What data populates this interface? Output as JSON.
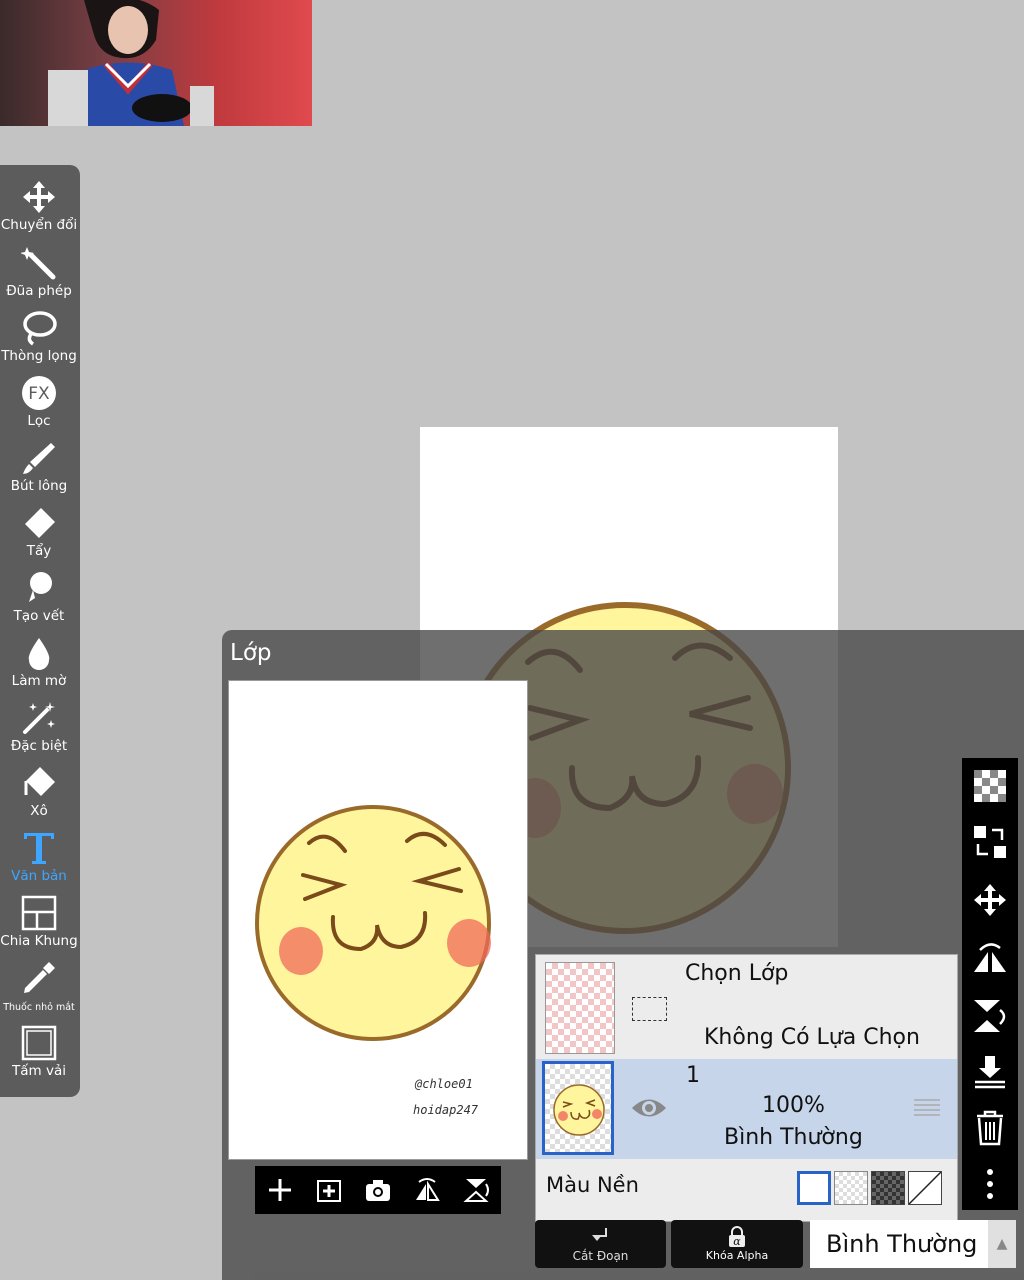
{
  "tools": [
    {
      "label": "Chuyển đổi",
      "icon": "move-icon"
    },
    {
      "label": "Đũa phép",
      "icon": "magic-wand-icon"
    },
    {
      "label": "Thòng lọng",
      "icon": "lasso-icon"
    },
    {
      "label": "Lọc",
      "icon": "fx-filter-icon"
    },
    {
      "label": "Bút lông",
      "icon": "brush-icon"
    },
    {
      "label": "Tẩy",
      "icon": "eraser-icon"
    },
    {
      "label": "Tạo vết",
      "icon": "smudge-icon"
    },
    {
      "label": "Làm mờ",
      "icon": "blur-drop-icon"
    },
    {
      "label": "Đặc biệt",
      "icon": "special-brush-icon"
    },
    {
      "label": "Xô",
      "icon": "bucket-icon"
    },
    {
      "label": "Văn bản",
      "icon": "text-icon",
      "active": true
    },
    {
      "label": "Chia Khung",
      "icon": "frame-divider-icon"
    },
    {
      "label": "Thuốc nhỏ mắt",
      "icon": "eyedropper-icon"
    },
    {
      "label": "Tấm vải",
      "icon": "canvas-icon"
    }
  ],
  "fx_text": "FX",
  "layer_panel": {
    "title": "Lớp",
    "preview_signature_1": "@chloe01",
    "preview_signature_2": "hoidap247",
    "selection_layer": {
      "title": "Chọn Lớp",
      "status": "Không Có Lựa Chọn"
    },
    "layer_1": {
      "name": "1",
      "opacity": "100%",
      "blend_mode": "Bình Thường"
    },
    "background": {
      "label": "Màu Nền"
    },
    "clipping_label": "Cắt Đoạn",
    "alpha_lock_label": "Khóa Alpha",
    "alpha_symbol": "α",
    "blend_select_value": "Bình Thường"
  },
  "colors": {
    "accent_blue": "#3ea6ff",
    "selected_layer_bg": "#c7d5ea",
    "emoji_face": "#fff59d",
    "emoji_outline": "#9a6a2a",
    "emoji_blush": "#f06a5a"
  }
}
